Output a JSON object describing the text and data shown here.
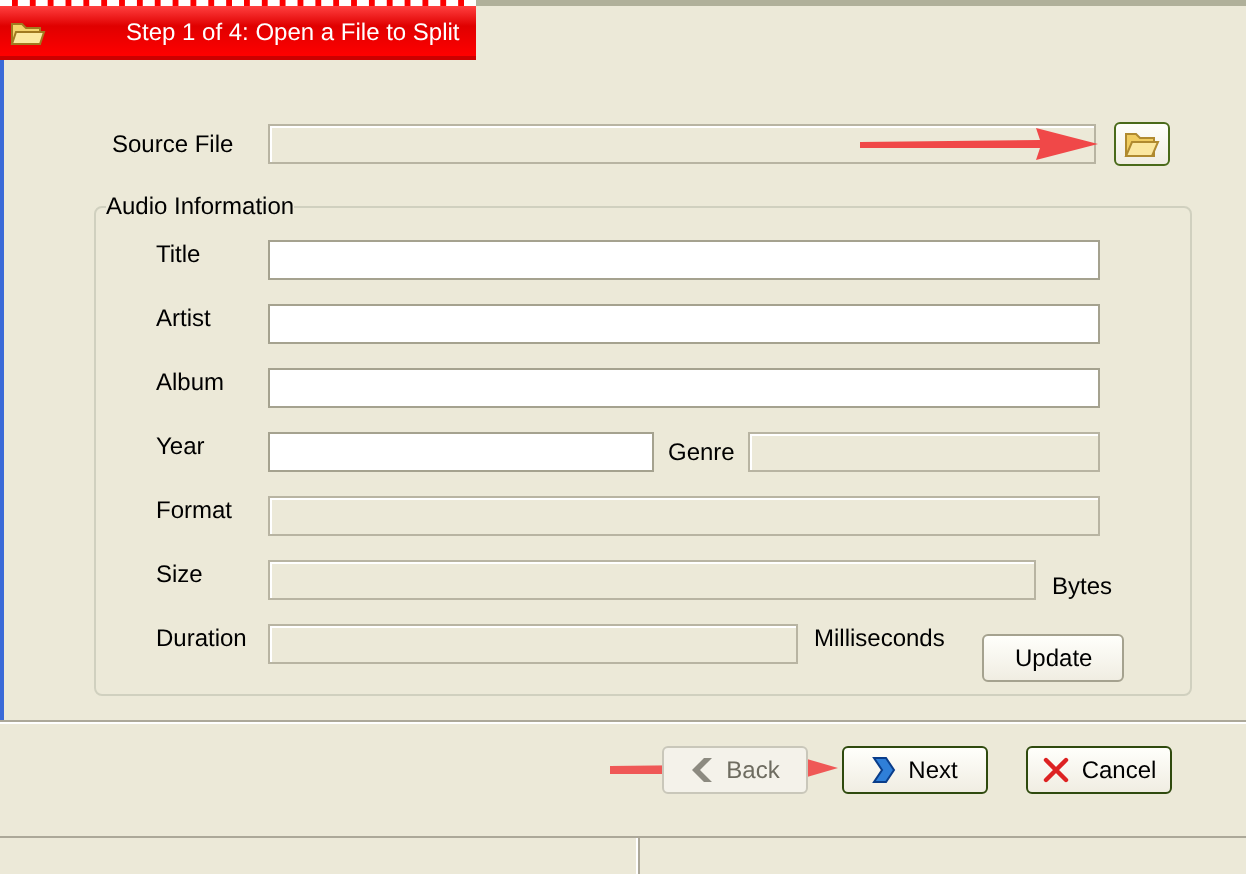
{
  "header": {
    "title": "Step 1 of 4:  Open a File to Split"
  },
  "source_file": {
    "label": "Source File",
    "disabled": true
  },
  "audio_information": {
    "title": "Audio Information",
    "rows": [
      {
        "kind": "full",
        "label": "Title",
        "disabled": false
      },
      {
        "kind": "full",
        "label": "Artist",
        "disabled": false
      },
      {
        "kind": "full",
        "label": "Album",
        "disabled": false
      },
      {
        "kind": "pair",
        "label": "Year",
        "disabled": false,
        "second_label": "Genre",
        "second_disabled": true
      },
      {
        "kind": "full",
        "label": "Format",
        "disabled": true
      },
      {
        "kind": "unit",
        "label": "Size",
        "disabled": true,
        "unit": "Bytes"
      },
      {
        "kind": "unit_button",
        "label": "Duration",
        "disabled": true,
        "unit": "Milliseconds",
        "button": "Update"
      }
    ]
  },
  "buttons": [
    {
      "kind": "back",
      "label": "Back",
      "disabled": true
    },
    {
      "kind": "next",
      "label": "Next",
      "disabled": false
    },
    {
      "kind": "cancel",
      "label": "Cancel",
      "disabled": false
    }
  ]
}
